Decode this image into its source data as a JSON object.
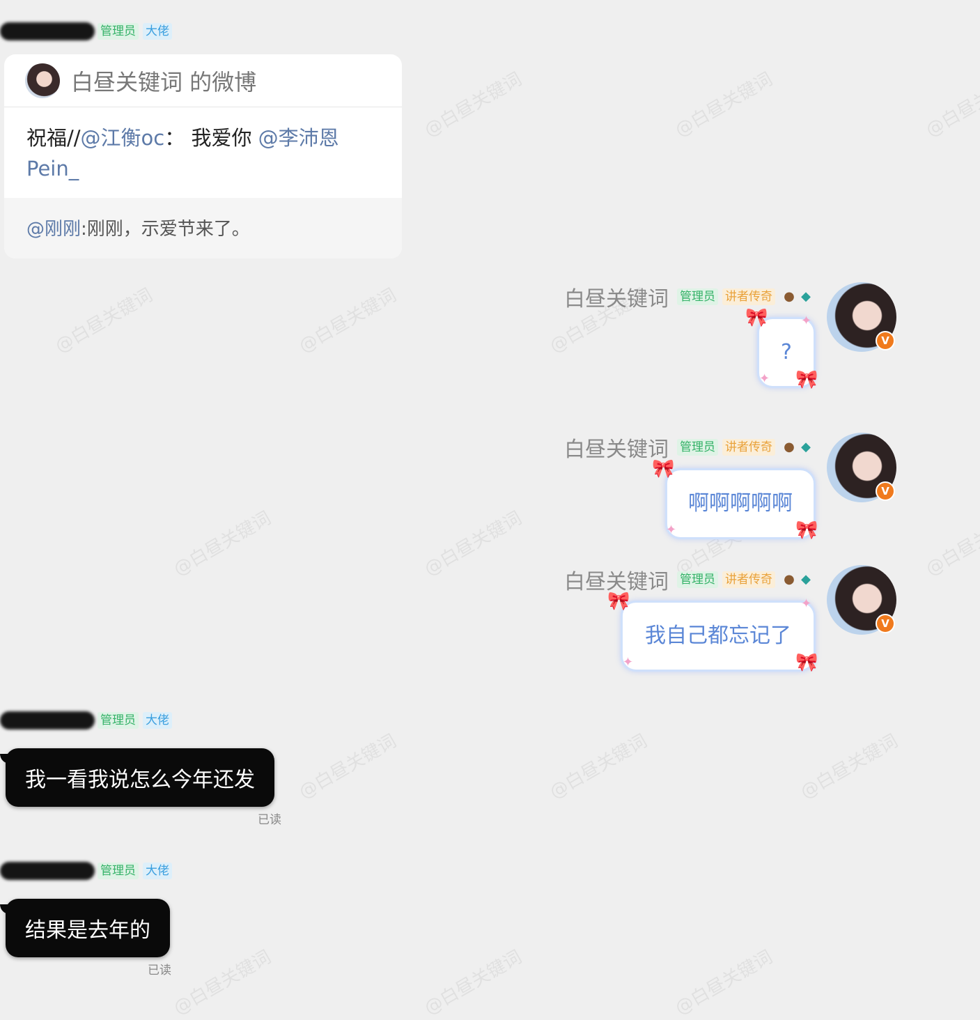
{
  "watermark": "@白昼关键词",
  "left_badges": [
    "管理员",
    "大佬"
  ],
  "right_badges": [
    "管理员",
    "讲者传奇"
  ],
  "weibo_card": {
    "title": "白昼关键词 的微博",
    "body_prefix": "祝福//",
    "mention_1": "@江衡oc",
    "body_mid": "： 我爱你 ",
    "mention_2": "@李沛恩Pein_",
    "footer_mention": "@刚刚",
    "footer_text": ":刚刚，示爱节来了。"
  },
  "right_messages": [
    {
      "name": "白昼关键词",
      "text": "?"
    },
    {
      "name": "白昼关键词",
      "text": "啊啊啊啊啊"
    },
    {
      "name": "白昼关键词",
      "text": "我自己都忘记了"
    }
  ],
  "left_messages": [
    {
      "text": "我一看我说怎么今年还发",
      "status": "已读"
    },
    {
      "text": "结果是去年的",
      "status": "已读"
    }
  ],
  "icons": {
    "verified": "V",
    "owl": "owl-icon",
    "bird": "bird-icon"
  }
}
